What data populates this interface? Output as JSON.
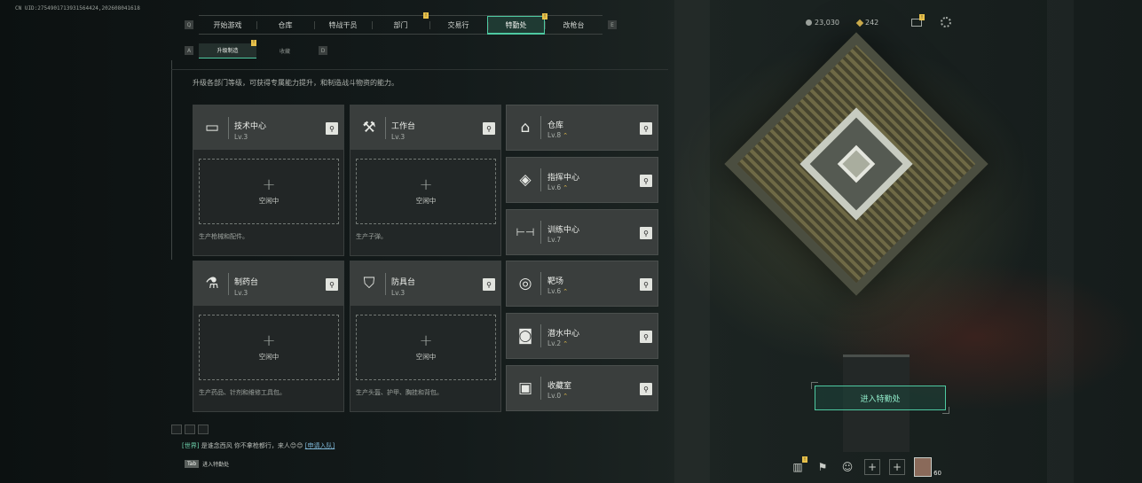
{
  "uid_text": "CN UID:2754901713931564424,202608041618",
  "nav": {
    "left_key": "Q",
    "right_key": "E",
    "tabs": [
      {
        "label": "开始游戏",
        "badge": ""
      },
      {
        "label": "仓库",
        "badge": ""
      },
      {
        "label": "特战干员",
        "badge": ""
      },
      {
        "label": "部门",
        "badge": ""
      },
      {
        "label": "交易行",
        "badge": "!"
      },
      {
        "label": "特勤处",
        "badge": "!",
        "active": true
      },
      {
        "label": "改枪台",
        "badge": ""
      }
    ]
  },
  "currency": {
    "coins": "23,030",
    "gems": "242"
  },
  "subtabs": {
    "left_key": "A",
    "right_key": "D",
    "items": [
      {
        "label": "升级制造",
        "active": true,
        "badge": "!"
      },
      {
        "label": "收藏",
        "active": false
      }
    ]
  },
  "description": "升级各部门等级，可获得专属能力提升，和制造战斗物资的能力。",
  "big_cards": [
    {
      "name": "技术中心",
      "level": "Lv.3",
      "icon": "monitor-icon",
      "glyph": "▭",
      "slot_text": "空闲中",
      "foot": "生产枪械和配件。"
    },
    {
      "name": "工作台",
      "level": "Lv.3",
      "icon": "tools-icon",
      "glyph": "⚒",
      "slot_text": "空闲中",
      "foot": "生产子弹。"
    },
    {
      "name": "制药台",
      "level": "Lv.3",
      "icon": "microscope-icon",
      "glyph": "⚗",
      "slot_text": "空闲中",
      "foot": "生产药品、针剂和维修工具包。"
    },
    {
      "name": "防具台",
      "level": "Lv.3",
      "icon": "armor-icon",
      "glyph": "⛉",
      "slot_text": "空闲中",
      "foot": "生产头盔、护甲、胸挂和背包。"
    }
  ],
  "small_cards": [
    {
      "name": "仓库",
      "level": "Lv.8",
      "icon": "warehouse-icon",
      "glyph": "⌂",
      "upgradable": true
    },
    {
      "name": "指挥中心",
      "level": "Lv.6",
      "icon": "command-icon",
      "glyph": "◈",
      "upgradable": true
    },
    {
      "name": "训练中心",
      "level": "Lv.7",
      "icon": "dumbbell-icon",
      "glyph": "⊢⊣",
      "upgradable": false
    },
    {
      "name": "靶场",
      "level": "Lv.6",
      "icon": "target-icon",
      "glyph": "◎",
      "upgradable": true
    },
    {
      "name": "潜水中心",
      "level": "Lv.2",
      "icon": "diving-mask-icon",
      "glyph": "◙",
      "upgradable": true
    },
    {
      "name": "收藏室",
      "level": "Lv.0",
      "icon": "collection-icon",
      "glyph": "▣",
      "upgradable": true
    }
  ],
  "up_glyph": "⌃",
  "search_glyph": "⚲",
  "plus_glyph": "+",
  "enter_button": "进入特勤处",
  "chat": {
    "channel": "[世界]",
    "message": "是谁念西风  你不拿枪都行，来人😊😊",
    "link": "[申请入队]"
  },
  "tab_hint": {
    "key": "Tab",
    "label": "进入特勤处"
  },
  "bottom_bar": {
    "avatar_level": "60"
  },
  "colors": {
    "accent": "#4ec9a1",
    "badge": "#e8c14a",
    "card_header": "#3a3e3d"
  }
}
